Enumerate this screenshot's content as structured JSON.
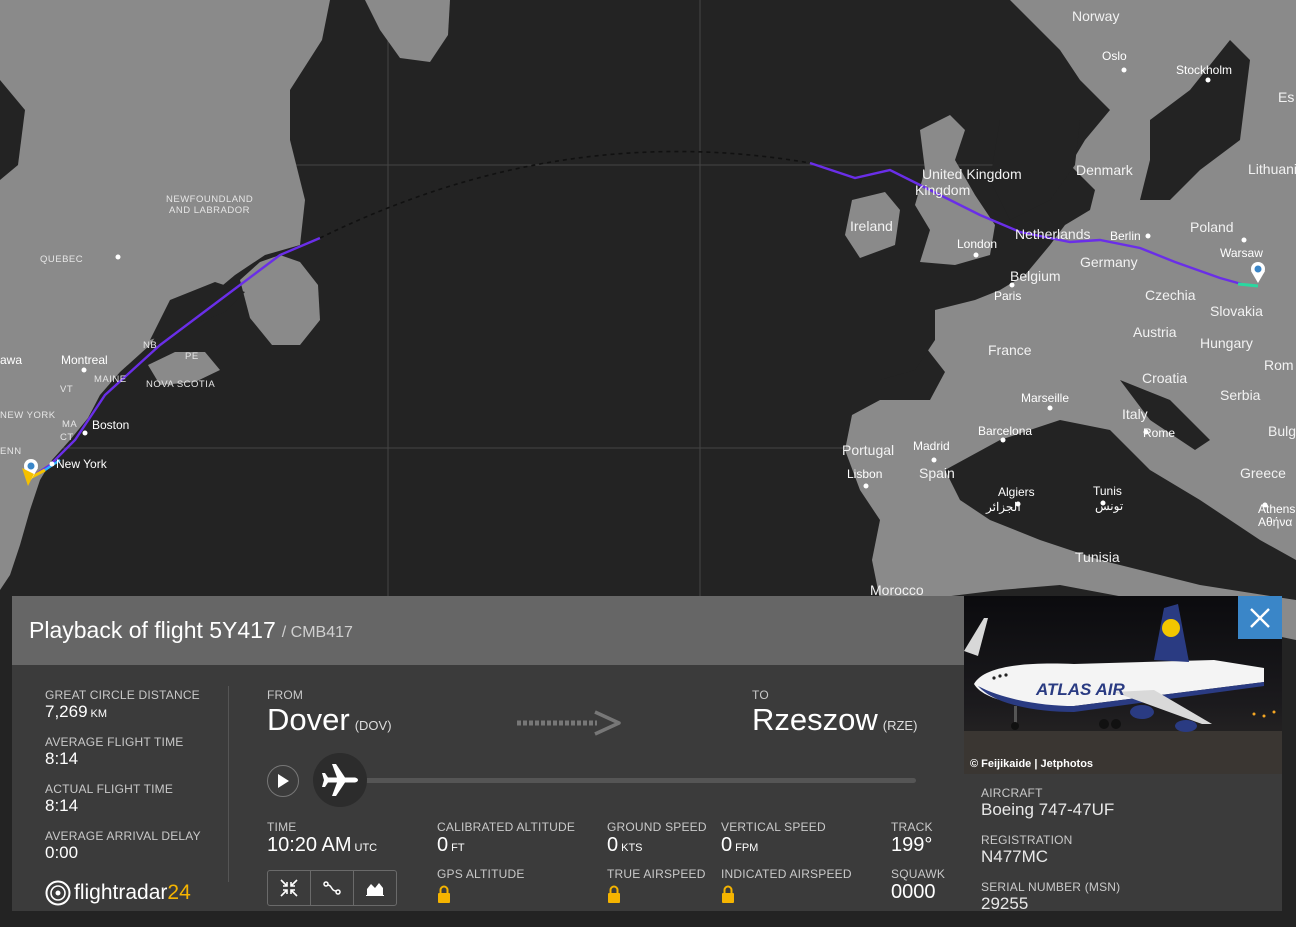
{
  "map": {
    "labels_country": [
      "Norway",
      "United Kingdom",
      "Ireland",
      "Netherlands",
      "Germany",
      "Poland",
      "Lithuania",
      "Belgium",
      "Czechia",
      "Slovakia",
      "France",
      "Austria",
      "Hungary",
      "Croatia",
      "Serbia",
      "Italy",
      "Portugal",
      "Spain",
      "Morocco",
      "Tunisia",
      "Greece",
      "Denmark",
      "Bulg",
      "Rom",
      "Es"
    ],
    "labels_city": [
      "Oslo",
      "Stockholm",
      "London",
      "Berlin",
      "Warsaw",
      "Paris",
      "Marseille",
      "Barcelona",
      "Madrid",
      "Lisbon",
      "Rome",
      "Algiers",
      "الجزائر",
      "Tunis",
      "تونس",
      "Athens",
      "Αθήνα",
      "Montreal",
      "Boston",
      "New York",
      "awa"
    ],
    "labels_region": [
      "NEWFOUNDLAND",
      "AND LABRADOR",
      "QUEBEC",
      "NOVA SCOTIA",
      "NB",
      "PE",
      "VT",
      "MAINE",
      "MA",
      "CT",
      "NEW YORK",
      "ENN"
    ],
    "origin_marker": "location-pin-icon",
    "destination_marker": "location-pin-icon",
    "track_color": "#6a2ee8"
  },
  "panel": {
    "title": "Playback of flight 5Y417",
    "callsign": "/ CMB417",
    "stats": [
      {
        "label": "GREAT CIRCLE DISTANCE",
        "value": "7,269",
        "unit": "KM"
      },
      {
        "label": "AVERAGE FLIGHT TIME",
        "value": "8:14",
        "unit": ""
      },
      {
        "label": "ACTUAL FLIGHT TIME",
        "value": "8:14",
        "unit": ""
      },
      {
        "label": "AVERAGE ARRIVAL DELAY",
        "value": "0:00",
        "unit": ""
      }
    ],
    "logo": {
      "main": "flightradar",
      "accent": "24"
    },
    "from": {
      "label": "FROM",
      "city": "Dover",
      "code": "(DOV)"
    },
    "to": {
      "label": "TO",
      "city": "Rzeszow",
      "code": "(RZE)"
    },
    "playback_progress": 0.0,
    "metrics": {
      "time": {
        "label": "TIME",
        "value": "10:20 AM",
        "unit": "UTC"
      },
      "cal_alt": {
        "label": "CALIBRATED ALTITUDE",
        "value": "0",
        "unit": "FT"
      },
      "gps_alt": {
        "label": "GPS ALTITUDE"
      },
      "ground_speed": {
        "label": "GROUND SPEED",
        "value": "0",
        "unit": "KTS"
      },
      "true_airspeed": {
        "label": "TRUE AIRSPEED"
      },
      "vert_speed": {
        "label": "VERTICAL SPEED",
        "value": "0",
        "unit": "FPM"
      },
      "ind_airspeed": {
        "label": "INDICATED AIRSPEED"
      },
      "track": {
        "label": "TRACK",
        "value": "199°"
      },
      "squawk": {
        "label": "SQUAWK",
        "value": "0000"
      }
    },
    "view_buttons": [
      "collapse-icon",
      "route-icon",
      "graph-icon"
    ]
  },
  "side": {
    "photo_credit": "© Feijikaide | Jetphotos",
    "livery_text": "ATLAS AIR",
    "aircraft": {
      "label": "AIRCRAFT",
      "value": "Boeing 747-47UF"
    },
    "registration": {
      "label": "REGISTRATION",
      "value": "N477MC"
    },
    "serial": {
      "label": "SERIAL NUMBER (MSN)",
      "value": "29255"
    }
  },
  "colors": {
    "accent_blue": "#3a86c8",
    "brand_yellow": "#f5b400",
    "lock_yellow": "#f5b400"
  }
}
